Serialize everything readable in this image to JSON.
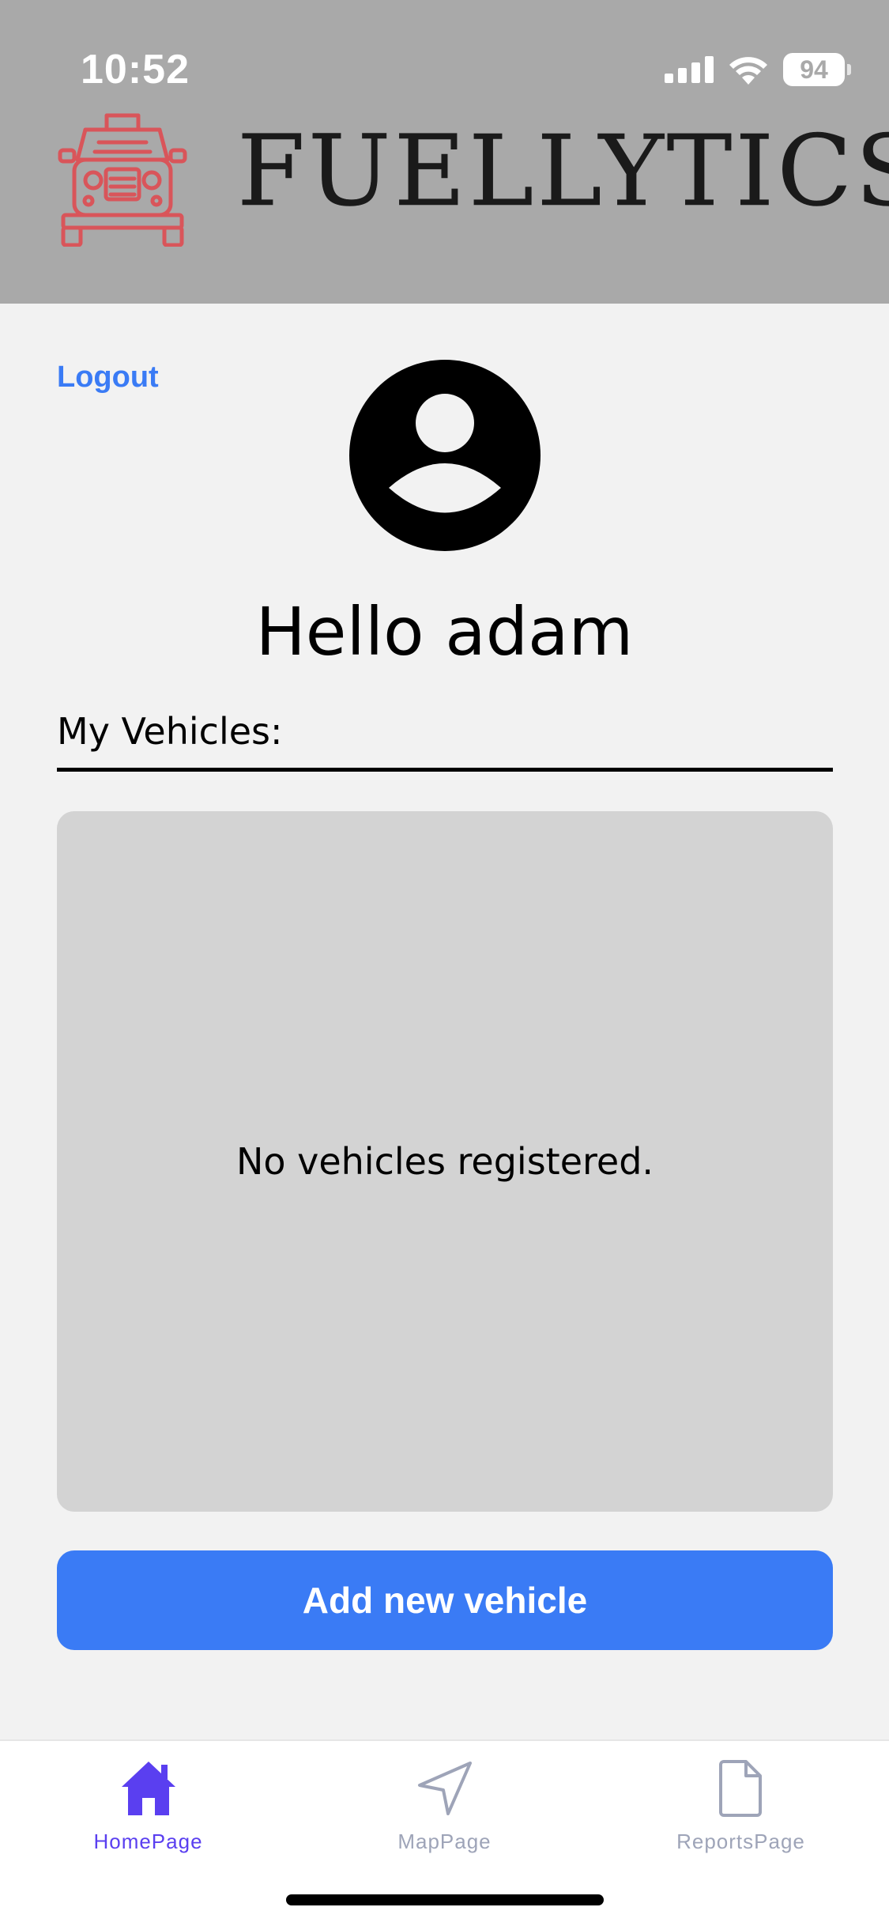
{
  "status_bar": {
    "time": "10:52",
    "battery": "94",
    "icons": [
      "signal-icon",
      "wifi-icon",
      "battery-icon"
    ]
  },
  "header": {
    "brand": "FUELLYTICS",
    "logo_icon": "truck-icon",
    "logo_color": "#d9555a",
    "background": "#a9a9a9"
  },
  "main": {
    "logout_label": "Logout",
    "avatar_icon": "user-avatar-icon",
    "greeting": "Hello adam",
    "section_label": "My Vehicles:",
    "empty_message": "No vehicles registered.",
    "add_button_label": "Add new vehicle",
    "accent": "#3a7bf5"
  },
  "tabs": [
    {
      "label": "HomePage",
      "icon": "home-icon",
      "active": true
    },
    {
      "label": "MapPage",
      "icon": "navigation-arrow-icon",
      "active": false
    },
    {
      "label": "ReportsPage",
      "icon": "document-icon",
      "active": false
    }
  ],
  "colors": {
    "tab_active": "#5a3ff0",
    "tab_inactive": "#9ea4b8"
  }
}
